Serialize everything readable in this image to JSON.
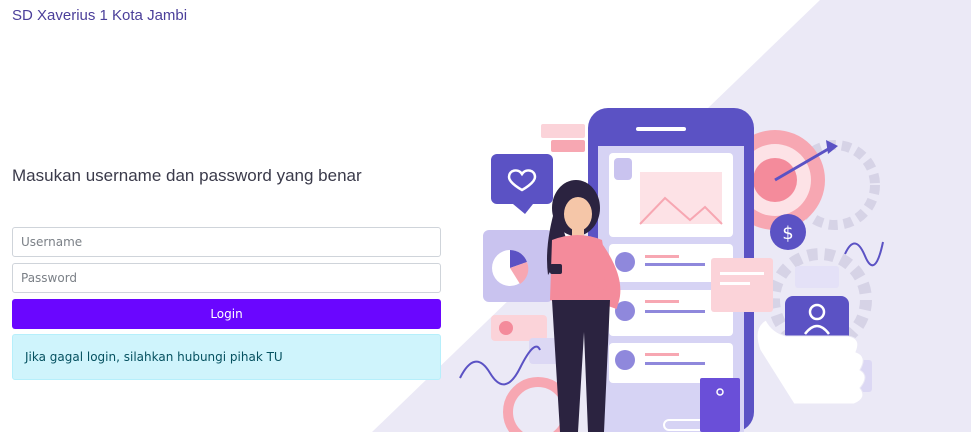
{
  "brand": {
    "name": "SD Xaverius 1 Kota Jambi"
  },
  "login": {
    "heading": "Masukan username dan password yang benar",
    "username_placeholder": "Username",
    "password_placeholder": "Password",
    "button_label": "Login",
    "info_message": "Jika gagal login, silahkan hubungi pihak TU"
  },
  "colors": {
    "brand_text": "#4b3f9a",
    "button_bg": "#6a06ff",
    "alert_bg": "#cff4fc",
    "diagonal_bg": "#ebe9f6",
    "illustration_primary": "#5b52c4",
    "illustration_accent": "#f48b9b"
  },
  "icons": [
    "heart-icon",
    "dollar-icon",
    "user-icon",
    "target-icon",
    "gear-icon",
    "image-icon",
    "shopping-bag-icon",
    "lock-icon"
  ]
}
